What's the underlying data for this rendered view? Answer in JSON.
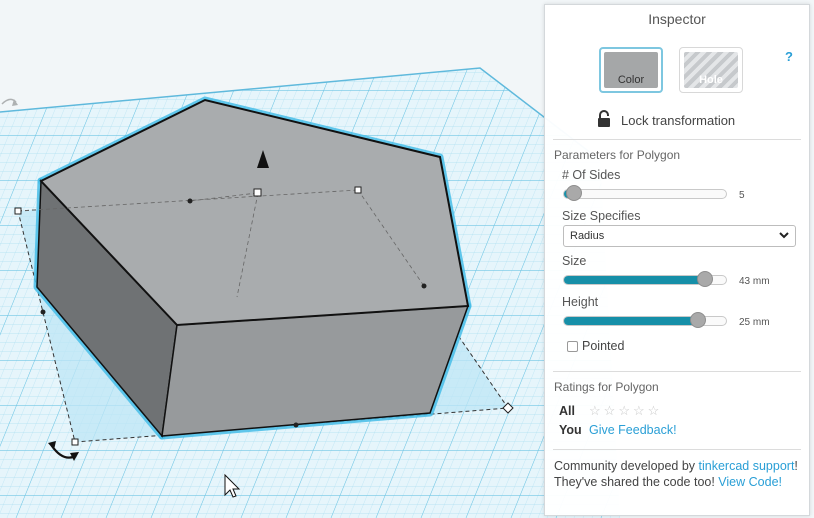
{
  "inspector": {
    "title": "Inspector",
    "color_label": "Color",
    "hole_label": "Hole",
    "help": "?",
    "lock_label": "Lock transformation"
  },
  "parameters": {
    "section_title": "Parameters for Polygon",
    "sides": {
      "label": "# Of Sides",
      "value": "5",
      "fraction": 0.06
    },
    "size_specifies": {
      "label": "Size Specifies",
      "selected": "Radius"
    },
    "size": {
      "label": "Size",
      "value": "43 mm",
      "fraction": 0.87
    },
    "height": {
      "label": "Height",
      "value": "25 mm",
      "fraction": 0.83
    },
    "pointed": {
      "label": "Pointed",
      "checked": false
    }
  },
  "ratings": {
    "section_title": "Ratings for Polygon",
    "all_label": "All",
    "you_label": "You",
    "feedback_link": "Give Feedback!",
    "stars": 5
  },
  "community": {
    "text1": "Community developed by ",
    "link1": "tinkercad support",
    "text1_end": "!",
    "text2": "They've shared the code too! ",
    "link2": "View Code!"
  },
  "colors": {
    "accent": "#168fa8",
    "link": "#2a9fd6",
    "grid_line": "#8fd3ea",
    "grid_bg": "#e8f6fb",
    "shape_top": "#a9acae",
    "shape_side_left": "#6f7274",
    "shape_side_front": "#979a9c",
    "selection_glow": "#46bde8"
  },
  "icons": [
    "lock-icon",
    "chevron-down-icon",
    "rotate-arrow-icon",
    "cone-handle-icon",
    "mouse-cursor-icon",
    "star-icon"
  ]
}
